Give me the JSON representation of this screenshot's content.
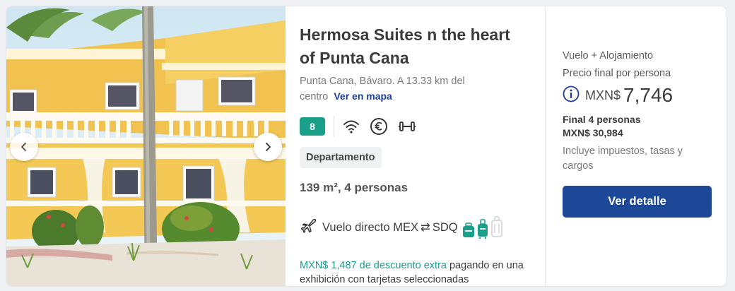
{
  "hotel": {
    "title": "Hermosa Suites n the heart of Punta Cana",
    "location": "Punta Cana, Bávaro. A 13.33 km del centro",
    "map_link": "Ver en mapa",
    "rating": "8",
    "amenity_icons": [
      "wifi-icon",
      "euro-icon",
      "gym-icon"
    ],
    "tag": "Departamento",
    "size": "139 m², 4 personas",
    "flight": {
      "label": "Vuelo directo MEX",
      "arrow": "⇄",
      "dest": "SDQ",
      "bag_icons": [
        "personal-bag-icon",
        "carry-on-icon",
        "checked-bag-icon"
      ]
    },
    "promo": {
      "highlight": "MXN$ 1,487 de descuento extra",
      "rest": " pagando en una exhibición con tarjetas seleccionadas"
    }
  },
  "price": {
    "package": "Vuelo + Alojamiento",
    "per_person_label": "Precio final por persona",
    "currency": "MXN$",
    "amount": "7,746",
    "total_label": "Final 4 personas",
    "total_value": "MXN$ 30,984",
    "taxes": "Incluye impuestos, tasas y cargos",
    "cta": "Ver detalle"
  },
  "colors": {
    "accent_green": "#1a9f8b",
    "brand_blue": "#1d4797",
    "link_blue": "#1d3f96"
  }
}
